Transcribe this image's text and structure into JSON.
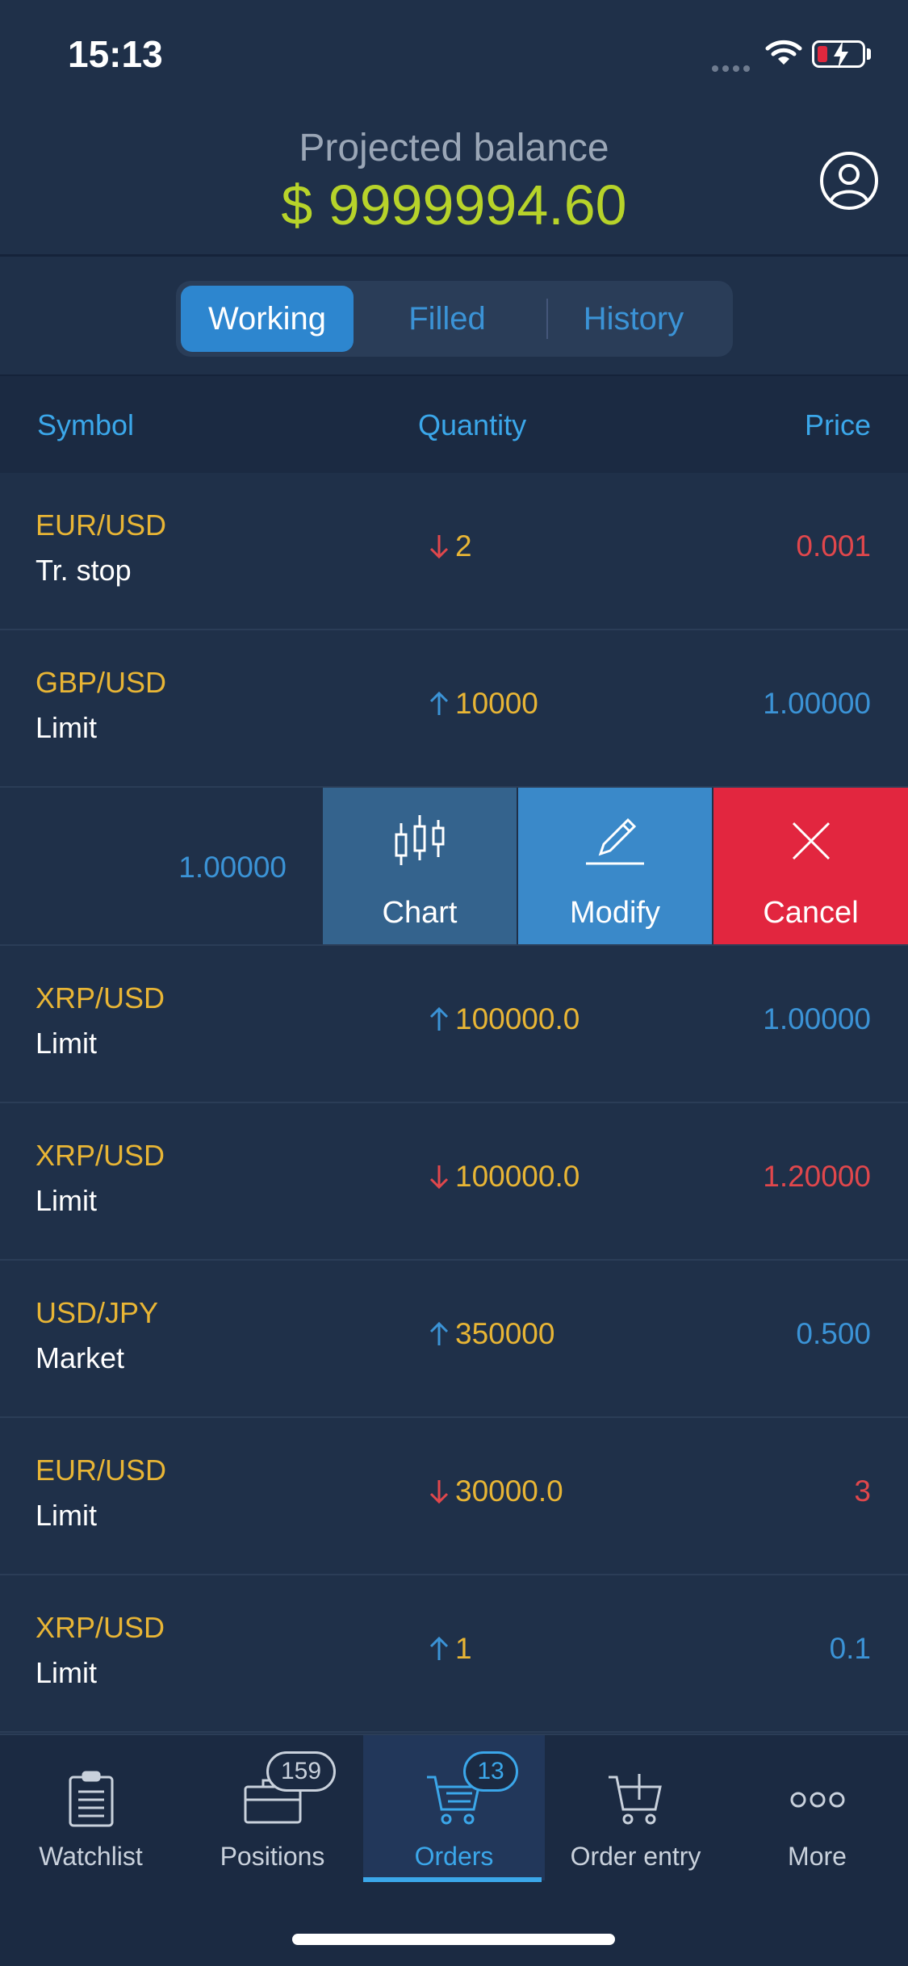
{
  "status_bar": {
    "time": "15:13"
  },
  "header": {
    "balance_label": "Projected balance",
    "balance_value": "$ 9999994.60"
  },
  "segments": {
    "working": "Working",
    "filled": "Filled",
    "history": "History",
    "selected": "Working"
  },
  "columns": {
    "symbol": "Symbol",
    "quantity": "Quantity",
    "price": "Price"
  },
  "orders": [
    {
      "symbol": "EUR/USD",
      "type": "Tr. stop",
      "direction": "down",
      "quantity": "2",
      "price": "0.001",
      "price_color": "#e0474c"
    },
    {
      "symbol": "GBP/USD",
      "type": "Limit",
      "direction": "up",
      "quantity": "10000",
      "price": "1.00000",
      "price_color": "#3b93d6"
    },
    {
      "symbol": "XRP/USD",
      "type": "Limit",
      "direction": "up",
      "quantity": "100000.0",
      "price": "1.00000",
      "price_color": "#3b93d6"
    },
    {
      "symbol": "XRP/USD",
      "type": "Limit",
      "direction": "down",
      "quantity": "100000.0",
      "price": "1.20000",
      "price_color": "#e0474c"
    },
    {
      "symbol": "USD/JPY",
      "type": "Market",
      "direction": "up",
      "quantity": "350000",
      "price": "0.500",
      "price_color": "#3b93d6"
    },
    {
      "symbol": "EUR/USD",
      "type": "Limit",
      "direction": "down",
      "quantity": "30000.0",
      "price": "3",
      "price_color": "#e0474c"
    },
    {
      "symbol": "XRP/USD",
      "type": "Limit",
      "direction": "up",
      "quantity": "1",
      "price": "0.1",
      "price_color": "#3b93d6"
    }
  ],
  "swipe_row": {
    "price": "1.00000",
    "actions": {
      "chart": "Chart",
      "modify": "Modify",
      "cancel": "Cancel"
    }
  },
  "tabs": {
    "watchlist": "Watchlist",
    "positions": "Positions",
    "positions_badge": "159",
    "orders": "Orders",
    "orders_badge": "13",
    "order_entry": "Order entry",
    "more": "More",
    "active": "Orders"
  },
  "colors": {
    "background": "#1f3049",
    "accent": "#3ba7ea",
    "symbol": "#e8b535",
    "balance": "#b7d32a",
    "sell": "#e0474c",
    "buy": "#3b93d6",
    "cancel": "#e2263f"
  }
}
